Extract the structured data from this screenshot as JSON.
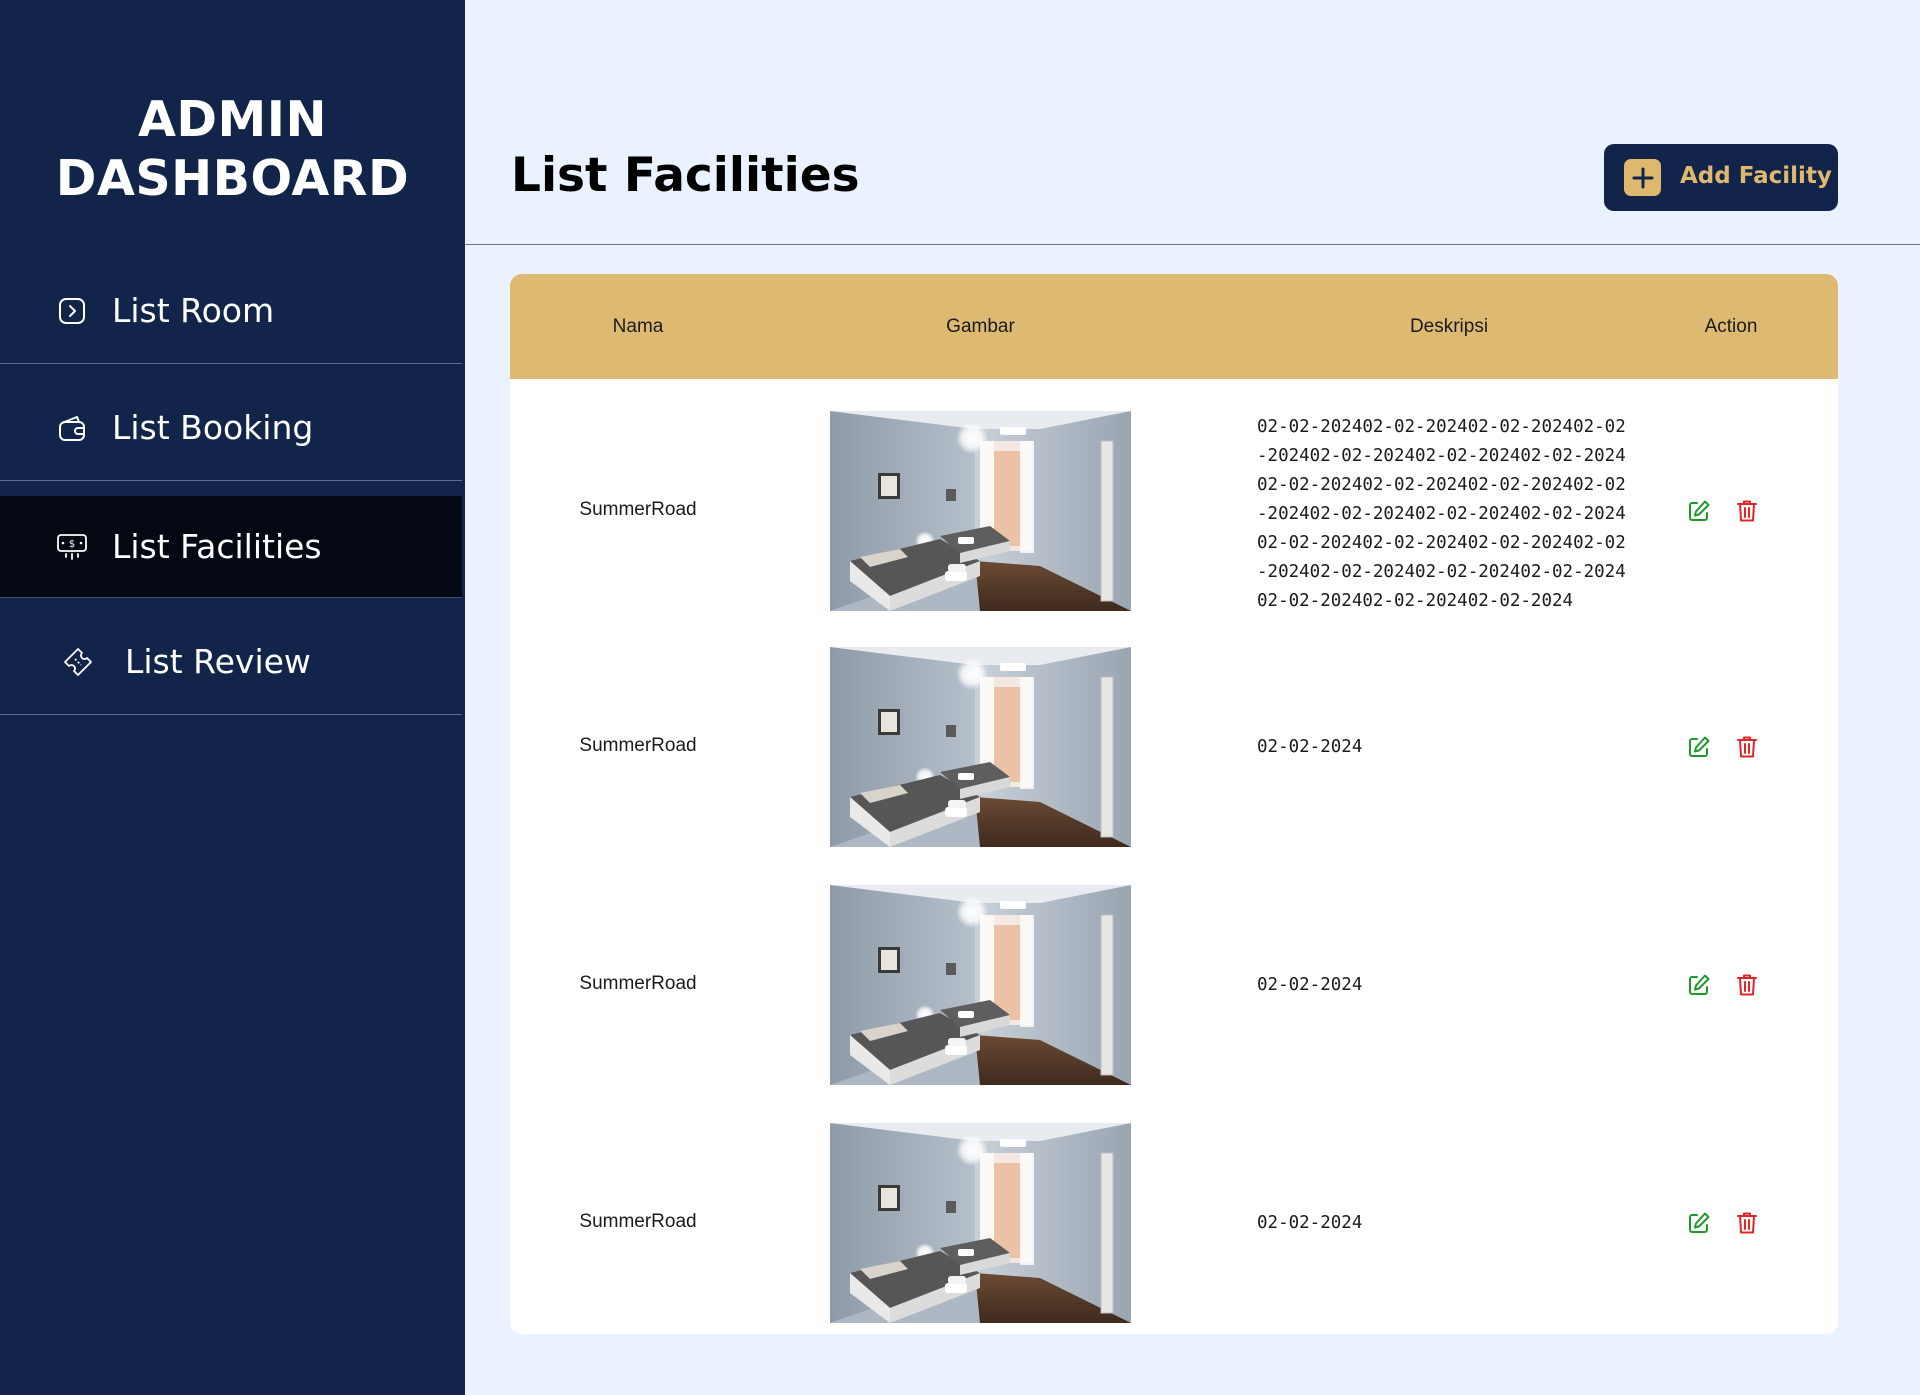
{
  "sidebar": {
    "brand_line1": "ADMIN",
    "brand_line2": "DASHBOARD",
    "items": [
      {
        "label": "List Room",
        "icon": "chevron-right-square-icon"
      },
      {
        "label": "List Booking",
        "icon": "wallet-icon"
      },
      {
        "label": "List Facilities",
        "icon": "cash-register-icon",
        "active": true
      },
      {
        "label": "List Review",
        "icon": "ticket-icon"
      }
    ]
  },
  "header": {
    "title": "List Facilities",
    "add_button_label": "Add Facility"
  },
  "table": {
    "columns": [
      "Nama",
      "Gambar",
      "Deskripsi",
      "Action"
    ],
    "rows": [
      {
        "name": "SummerRoad",
        "image": "bedroom-photo",
        "description": "02-02-202402-02-202402-02-202402-02-202402-02-202402-02-202402-02-202402-02-202402-02-202402-02-202402-02-202402-02-202402-02-202402-02-202402-02-202402-02-202402-02-202402-02-202402-02-202402-02-202402-02-202402-02-202402-02-202402-02-2024"
      },
      {
        "name": "SummerRoad",
        "image": "bedroom-photo",
        "description": "02-02-2024"
      },
      {
        "name": "SummerRoad",
        "image": "bedroom-photo",
        "description": "02-02-2024"
      },
      {
        "name": "SummerRoad",
        "image": "bedroom-photo",
        "description": "02-02-2024"
      }
    ]
  },
  "colors": {
    "sidebar_bg": "#13244a",
    "active_item_bg": "#030812",
    "accent_gold": "#dfb870",
    "page_bg": "#eaf1ff",
    "edit_green": "#1e9a2a",
    "delete_red": "#e02424"
  }
}
